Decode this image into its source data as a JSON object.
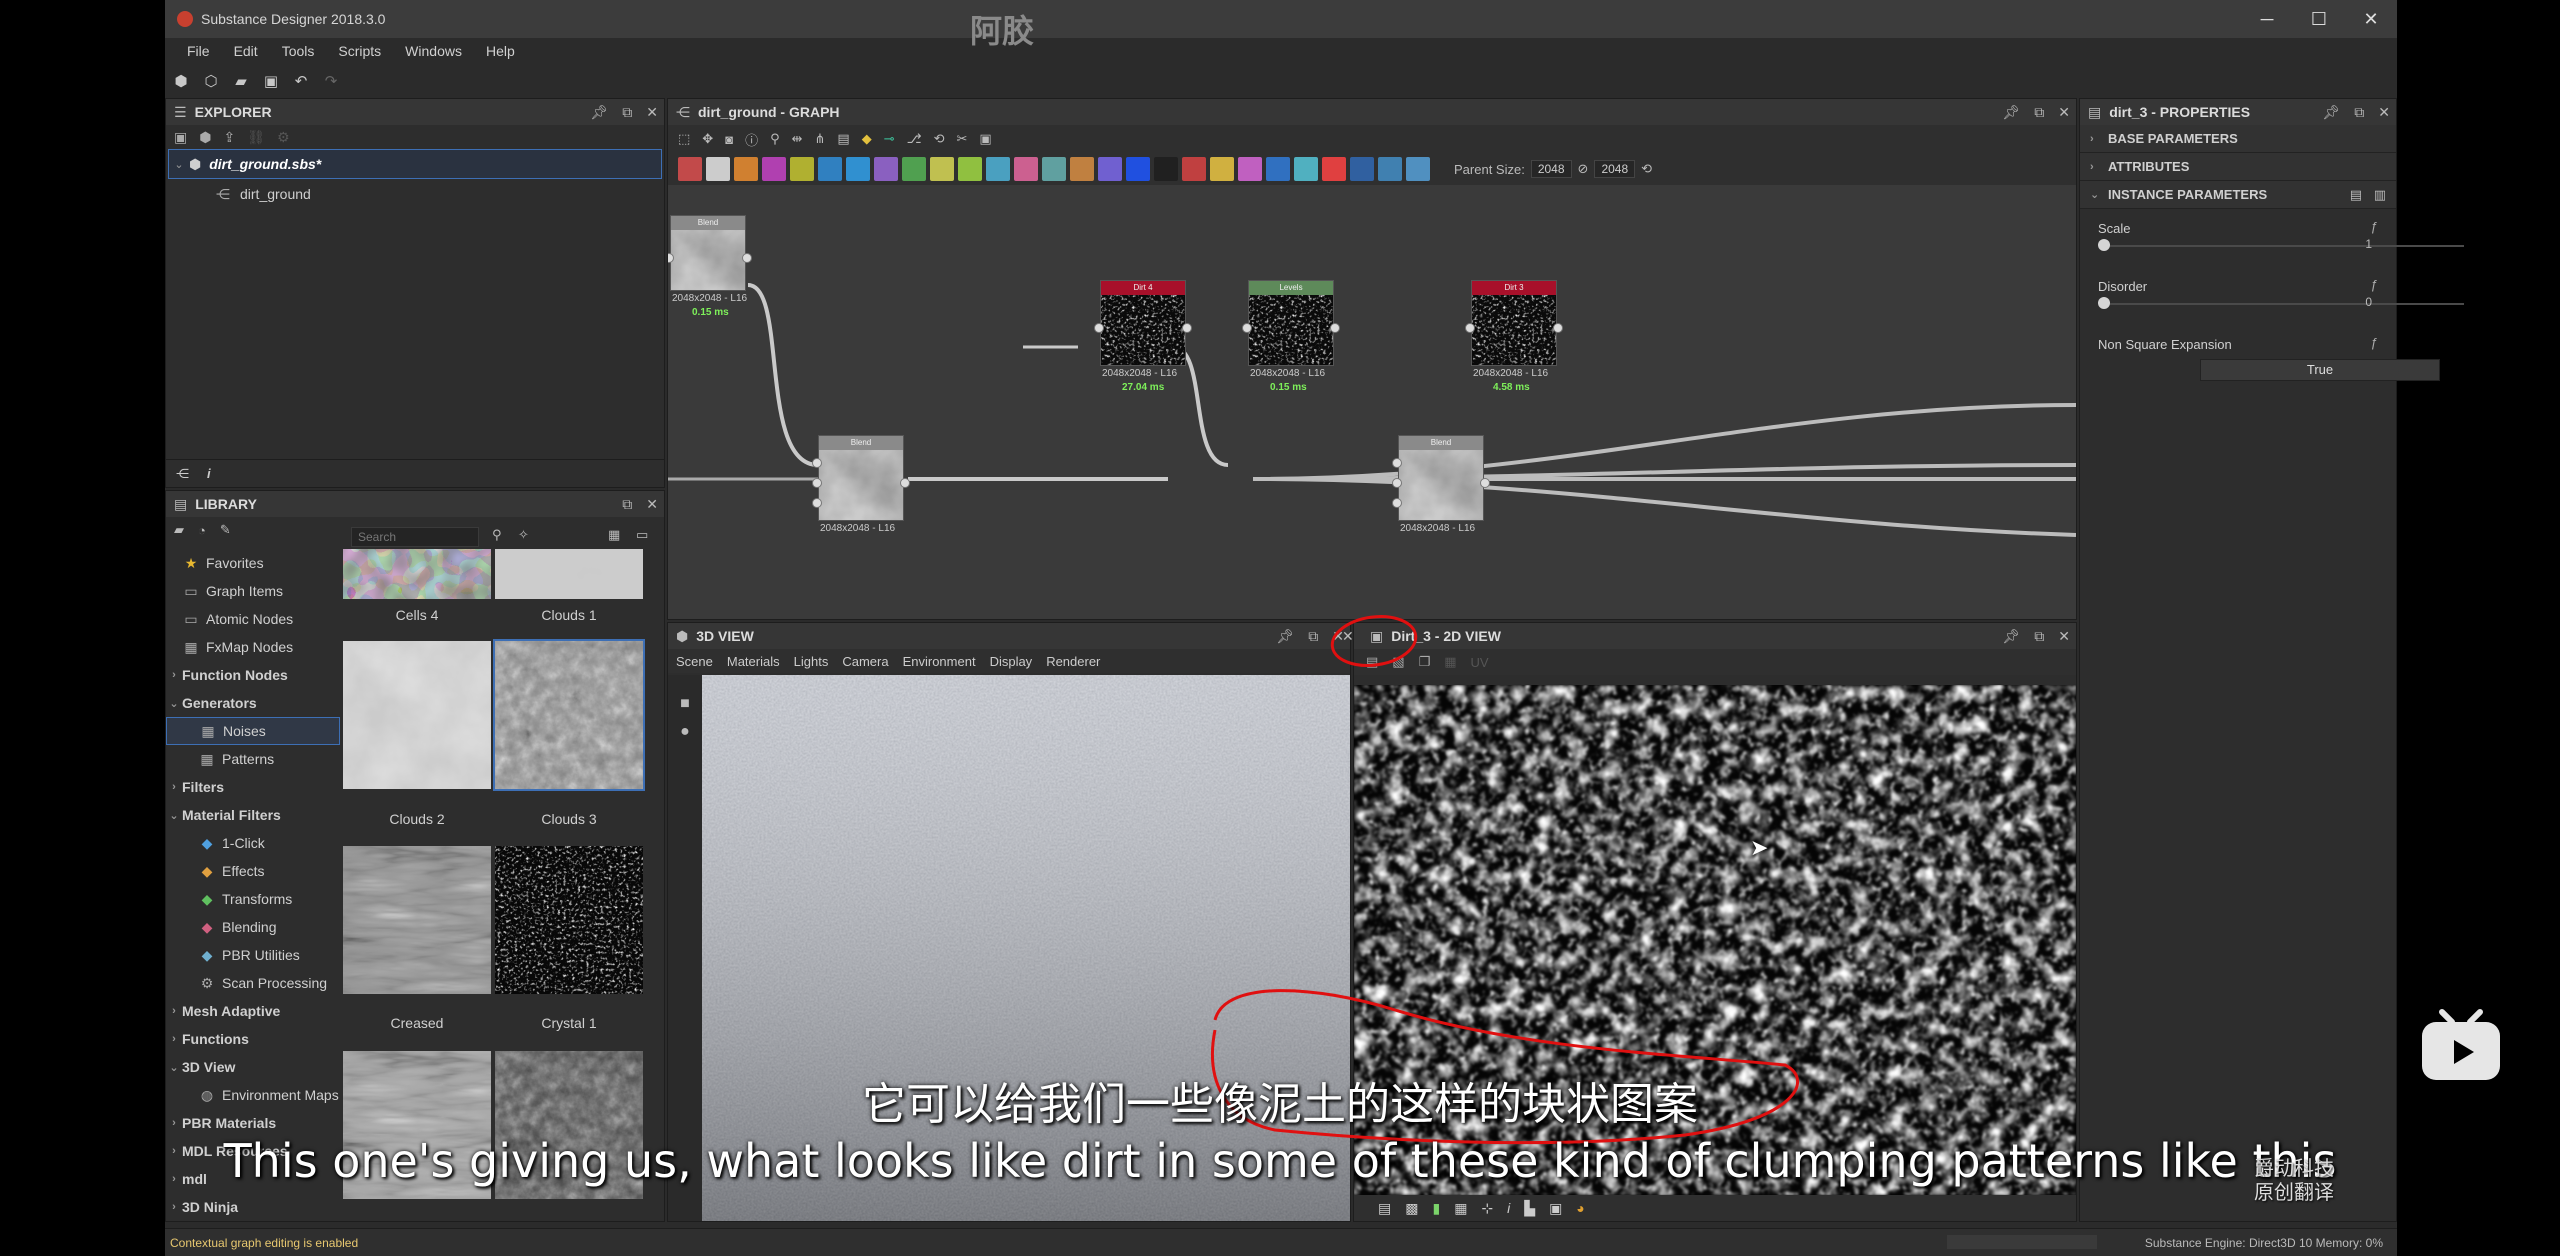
{
  "window": {
    "title": "Substance Designer 2018.3.0",
    "watermark": "阿胶",
    "minimize": "─",
    "maximize": "☐",
    "close": "✕"
  },
  "menu": [
    "File",
    "Edit",
    "Tools",
    "Scripts",
    "Windows",
    "Help"
  ],
  "explorer": {
    "title": "EXPLORER",
    "package": "dirt_ground.sbs*",
    "graph": "dirt_ground"
  },
  "library": {
    "title": "LIBRARY",
    "search_placeholder": "Search",
    "tree": [
      {
        "label": "Favorites",
        "icon": "★",
        "arrow": "",
        "bold": false
      },
      {
        "label": "Graph Items",
        "icon": "▭",
        "arrow": "",
        "bold": false
      },
      {
        "label": "Atomic Nodes",
        "icon": "▭",
        "arrow": "",
        "bold": false
      },
      {
        "label": "FxMap Nodes",
        "icon": "▦",
        "arrow": "",
        "bold": false
      },
      {
        "label": "Function Nodes",
        "icon": "",
        "arrow": "›",
        "bold": true
      },
      {
        "label": "Generators",
        "icon": "",
        "arrow": "⌄",
        "bold": true
      },
      {
        "label": "Noises",
        "icon": "▦",
        "arrow": "",
        "bold": false,
        "indent": true,
        "selected": true
      },
      {
        "label": "Patterns",
        "icon": "▦",
        "arrow": "",
        "bold": false,
        "indent": true
      },
      {
        "label": "Filters",
        "icon": "",
        "arrow": "›",
        "bold": true
      },
      {
        "label": "Material Filters",
        "icon": "",
        "arrow": "⌄",
        "bold": true
      },
      {
        "label": "1-Click",
        "icon": "◆",
        "arrow": "",
        "bold": false,
        "indent": true
      },
      {
        "label": "Effects",
        "icon": "◆",
        "arrow": "",
        "bold": false,
        "indent": true
      },
      {
        "label": "Transforms",
        "icon": "◆",
        "arrow": "",
        "bold": false,
        "indent": true
      },
      {
        "label": "Blending",
        "icon": "◆",
        "arrow": "",
        "bold": false,
        "indent": true
      },
      {
        "label": "PBR Utilities",
        "icon": "◆",
        "arrow": "",
        "bold": false,
        "indent": true
      },
      {
        "label": "Scan Processing",
        "icon": "⚙",
        "arrow": "",
        "bold": false,
        "indent": true
      },
      {
        "label": "Mesh Adaptive",
        "icon": "",
        "arrow": "›",
        "bold": true
      },
      {
        "label": "Functions",
        "icon": "",
        "arrow": "›",
        "bold": true
      },
      {
        "label": "3D View",
        "icon": "",
        "arrow": "⌄",
        "bold": true
      },
      {
        "label": "Environment Maps",
        "icon": "◍",
        "arrow": "",
        "bold": false,
        "indent": true
      },
      {
        "label": "PBR Materials",
        "icon": "",
        "arrow": "›",
        "bold": true
      },
      {
        "label": "MDL Resources",
        "icon": "",
        "arrow": "›",
        "bold": true
      },
      {
        "label": "mdl",
        "icon": "",
        "arrow": "›",
        "bold": true
      },
      {
        "label": "3D Ninja",
        "icon": "",
        "arrow": "›",
        "bold": true
      }
    ],
    "thumbnails": [
      {
        "label": "Cells 4"
      },
      {
        "label": "Clouds 1"
      },
      {
        "label": "Clouds 2"
      },
      {
        "label": "Clouds 3",
        "selected": true
      },
      {
        "label": "Creased"
      },
      {
        "label": "Crystal 1"
      },
      {
        "label": ""
      },
      {
        "label": ""
      }
    ]
  },
  "graph": {
    "title": "dirt_ground - GRAPH",
    "parent_size_label": "Parent Size:",
    "parent_size_w": "2048",
    "parent_size_h": "2048",
    "nodes": [
      {
        "name": "Blend",
        "size": "2048x2048 - L16",
        "time": "0.15 ms",
        "color": "#8a8a8a"
      },
      {
        "name": "Dirt 4",
        "size": "2048x2048 - L16",
        "time": "27.04 ms",
        "color": "#a8102a"
      },
      {
        "name": "Levels",
        "size": "2048x2048 - L16",
        "time": "0.15 ms",
        "color": "#5e8a5a"
      },
      {
        "name": "Dirt 3",
        "size": "2048x2048 - L16",
        "time": "4.58 ms",
        "color": "#a8102a"
      },
      {
        "name": "Blend",
        "size": "2048x2048 - L16",
        "time": "",
        "color": "#8a8a8a"
      },
      {
        "name": "Blend",
        "size": "2048x2048 - L16",
        "time": "",
        "color": "#8a8a8a"
      }
    ]
  },
  "properties": {
    "title": "dirt_3 - PROPERTIES",
    "sections": [
      "BASE PARAMETERS",
      "ATTRIBUTES",
      "INSTANCE PARAMETERS"
    ],
    "params": [
      {
        "label": "Scale",
        "value": "1",
        "level": 0
      },
      {
        "label": "Disorder",
        "value": "0",
        "level": 0
      },
      {
        "label": "Non Square Expansion",
        "button": "True"
      }
    ]
  },
  "view3d": {
    "title": "3D VIEW",
    "menu": [
      "Scene",
      "Materials",
      "Lights",
      "Camera",
      "Environment",
      "Display",
      "Renderer"
    ]
  },
  "view2d": {
    "title": "Dirt_3 - 2D VIEW",
    "uv_label": "UV"
  },
  "status": {
    "left": "Contextual graph editing is enabled",
    "right": "Substance Engine: Direct3D 10  Memory: 0%"
  },
  "subtitles": {
    "cn": "它可以给我们一些像泥土的这样的块状图案",
    "en": "This one's giving us, what looks like dirt in some of these kind of clumping patterns like this",
    "brand_line1": "爵动科技",
    "brand_line2": "原创翻译"
  },
  "colors": {
    "accent": "#3d6fb5",
    "annotation": "#e01010",
    "timing": "#7ef05a",
    "status_text": "#e8c870"
  }
}
